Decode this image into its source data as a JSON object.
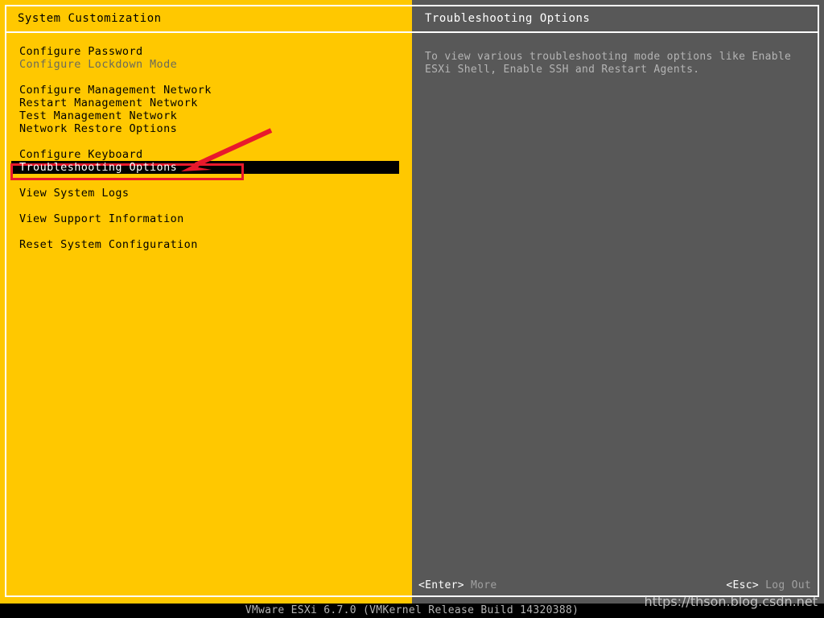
{
  "colors": {
    "panel_left_bg": "#ffc800",
    "panel_right_bg": "#585858",
    "selection_bg": "#000000",
    "selection_fg": "#ffffff",
    "annotation_red": "#e8192c",
    "disabled_fg": "#6b6b5a",
    "status_bar_bg": "#000000"
  },
  "left_panel": {
    "title": "System Customization",
    "menu": [
      {
        "label": "Configure Password",
        "state": "normal"
      },
      {
        "label": "Configure Lockdown Mode",
        "state": "disabled"
      },
      {
        "label": "",
        "state": "spacer"
      },
      {
        "label": "Configure Management Network",
        "state": "normal"
      },
      {
        "label": "Restart Management Network",
        "state": "normal"
      },
      {
        "label": "Test Management Network",
        "state": "normal"
      },
      {
        "label": "Network Restore Options",
        "state": "normal"
      },
      {
        "label": "",
        "state": "spacer"
      },
      {
        "label": "Configure Keyboard",
        "state": "normal"
      },
      {
        "label": "Troubleshooting Options",
        "state": "selected"
      },
      {
        "label": "",
        "state": "spacer"
      },
      {
        "label": "View System Logs",
        "state": "normal"
      },
      {
        "label": "",
        "state": "spacer"
      },
      {
        "label": "View Support Information",
        "state": "normal"
      },
      {
        "label": "",
        "state": "spacer"
      },
      {
        "label": "Reset System Configuration",
        "state": "normal"
      }
    ]
  },
  "right_panel": {
    "title": "Troubleshooting Options",
    "description_lines": [
      "To view various troubleshooting mode options like Enable",
      "ESXi Shell, Enable SSH and Restart Agents."
    ],
    "footer": {
      "left_key": "<Enter>",
      "left_desc": "More",
      "right_key": "<Esc>",
      "right_desc": "Log Out"
    }
  },
  "status_bar": {
    "text": "VMware ESXi 6.7.0 (VMKernel Release Build 14320388)"
  },
  "watermark": {
    "text": "https://thson.blog.csdn.net"
  },
  "annotations": {
    "highlight_box_target": "Troubleshooting Options",
    "arrow_points_to": "Troubleshooting Options"
  }
}
